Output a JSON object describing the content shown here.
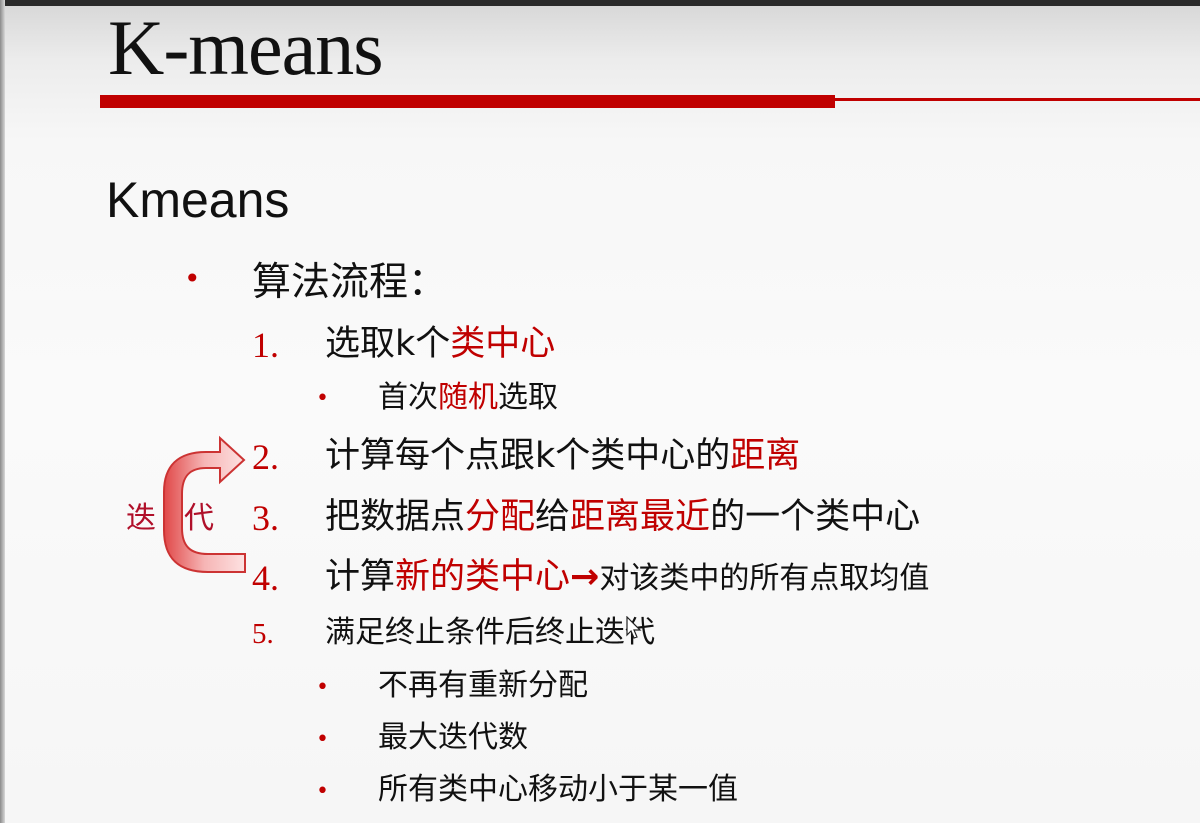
{
  "slide": {
    "title": "K-means",
    "heading": "Kmeans",
    "bullet": "算法流程："
  },
  "steps": [
    {
      "num": "1.",
      "parts": [
        "选取k个",
        "类中心"
      ]
    },
    {
      "num": "2.",
      "parts": [
        "计算每个点跟k个类中心的",
        "距离"
      ]
    },
    {
      "num": "3.",
      "parts": [
        "把数据点",
        "分配",
        "给",
        "距离最近",
        "的一个类中心"
      ]
    },
    {
      "num": "4.",
      "parts": [
        "计算",
        "新的类中心",
        "→",
        "对该类中的所有点取均值"
      ]
    },
    {
      "num": "5.",
      "parts": [
        "满足终止条件后终止迭代"
      ]
    }
  ],
  "step1_sub": {
    "parts": [
      "首次",
      "随机",
      "选取"
    ]
  },
  "stop_conditions": [
    "不再有重新分配",
    "最大迭代数",
    "所有类中心移动小于某一值"
  ],
  "loop_label": [
    "迭",
    "代"
  ],
  "colors": {
    "accent": "#c00000",
    "text": "#111111",
    "loop_arrow": "#e87575"
  }
}
